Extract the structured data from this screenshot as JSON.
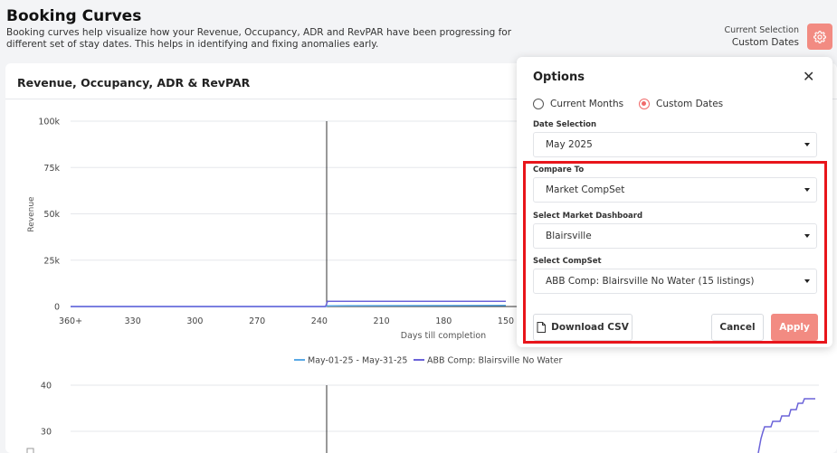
{
  "header": {
    "title": "Booking Curves",
    "description": "Booking curves help visualize how your Revenue, Occupancy, ADR and RevPAR have been progressing for different set of stay dates. This helps in identifying and fixing anomalies early.",
    "current_selection_label": "Current Selection",
    "current_selection_value": "Custom Dates",
    "settings_icon": "gear-icon",
    "accent_color": "#f28b82"
  },
  "card": {
    "title": "Revenue, Occupancy, ADR & RevPAR"
  },
  "chart_data": [
    {
      "type": "line",
      "ylabel": "Revenue",
      "xlabel": "Days till completion",
      "y_ticks": [
        "100k",
        "75k",
        "50k",
        "25k",
        "0"
      ],
      "x_ticks": [
        "360+",
        "330",
        "300",
        "270",
        "240",
        "210",
        "180",
        "150"
      ],
      "ylim": [
        0,
        100000
      ],
      "x_reversed": true,
      "grid": true,
      "legend_position": "bottom-center",
      "series": [
        {
          "name": "May-01-25 - May-31-25",
          "color": "#5aa9e6",
          "points": [
            [
              365,
              0
            ],
            [
              237,
              0
            ],
            [
              236,
              400
            ],
            [
              150,
              600
            ]
          ]
        },
        {
          "name": "ABB Comp: Blairsville No Water",
          "color": "#6b63d9",
          "points": [
            [
              365,
              0
            ],
            [
              237,
              0
            ],
            [
              236,
              2800
            ],
            [
              150,
              2800
            ]
          ]
        }
      ]
    },
    {
      "type": "line",
      "y_ticks": [
        "40",
        "30"
      ],
      "series_color": "#6b63d9",
      "partial": true
    }
  ],
  "options_panel": {
    "title": "Options",
    "close_icon": "close-icon",
    "radio_current_months": "Current Months",
    "radio_custom_dates": "Custom Dates",
    "selected_mode": "Custom Dates",
    "date_selection_label": "Date Selection",
    "date_selection_value": "May 2025",
    "compare_to_label": "Compare To",
    "compare_to_value": "Market CompSet",
    "market_dashboard_label": "Select Market Dashboard",
    "market_dashboard_value": "Blairsville",
    "compset_label": "Select CompSet",
    "compset_value": "ABB Comp: Blairsville No Water (15 listings)",
    "download_label": "Download CSV",
    "cancel_label": "Cancel",
    "apply_label": "Apply",
    "highlight_color": "#e8151b"
  }
}
